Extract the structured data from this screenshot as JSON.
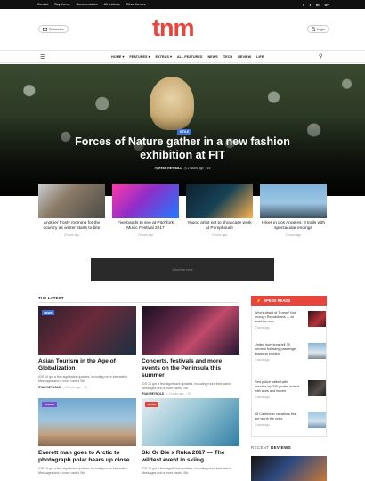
{
  "topbar": {
    "links": [
      "Contact",
      "Buy theme",
      "Documentation",
      "All features",
      "Other themes"
    ],
    "social": [
      "f",
      "t",
      "in",
      "G+"
    ]
  },
  "header": {
    "subscribe": "Subscribe",
    "logo": "tnm",
    "login": "Login",
    "brand_color": "#e8453c"
  },
  "nav": {
    "items": [
      "HOME ▾",
      "FEATURES ▾",
      "EXTRAS ▾",
      "ALL FEATURES",
      "NEWS",
      "TECH",
      "REVIEW",
      "LIFE"
    ]
  },
  "hero": {
    "category": "STYLE",
    "title": "Forces of Nature gather in a new fashion exhibition at FIT",
    "by": "by",
    "author": "RYAN REYNOLD",
    "date": "2 hours ago",
    "comments": "15"
  },
  "sub_stories": [
    {
      "title": "Another frosty morning for the country as winter starts to bite",
      "time": "2 hours ago"
    },
    {
      "title": "Five bands to see at Pitchfork Music Festival 2017",
      "time": "2 hours ago"
    },
    {
      "title": "Young artist set to showcase work at Pumphouse",
      "time": "2 hours ago"
    },
    {
      "title": "Hikes in Los Angeles: 8 trails with spectacular endings",
      "time": "2 hours ago"
    }
  ],
  "ad": {
    "text": "Advertise here"
  },
  "latest": {
    "title": "THE LATEST",
    "cards": [
      {
        "tag": "NEWS",
        "tag_color": "#3b6fd4",
        "title": "Asian Tourism in the Age of Globalization",
        "excerpt": "iOS 10 got a few significant updates, including more interactive Messages and a more useful Siri.",
        "author": "RYAN REYNOLD",
        "time": "2 hours ago",
        "comments": "13"
      },
      {
        "tag": "",
        "tag_color": "",
        "title": "Concerts, festivals and more events on the Peninsula this summer",
        "excerpt": "iOS 10 got a few significant updates, including more interactive Messages and a more useful Siri.",
        "author": "RYAN REYNOLD",
        "time": "2 hours ago",
        "comments": "13"
      },
      {
        "tag": "TRAVEL",
        "tag_color": "#7b4fd4",
        "title": "Everett man goes to Arctic to photograph polar bears up close",
        "excerpt": "iOS 10 got a few significant updates, including more interactive Messages and a more useful Siri.",
        "author": "",
        "time": "",
        "comments": ""
      },
      {
        "tag": "SPORT",
        "tag_color": "#e8453c",
        "title": "Ski Or Die x Ruka 2017 — The wildest event in skiing",
        "excerpt": "iOS 10 got a few significant updates, including more interactive Messages and a more useful Siri.",
        "author": "",
        "time": "",
        "comments": ""
      }
    ]
  },
  "speed_reads": {
    "label": "SPEED READS",
    "items": [
      {
        "title": "Who's afraid of Trump? Not enough Republicans — at least for now",
        "time": "2 hours ago"
      },
      {
        "title": "United bumpings fell 79 percent following passenger dragging incident",
        "time": "2 hours ago"
      },
      {
        "title": "Red police patted with missiles by 200 youths armed with axes and knives",
        "time": "2 hours ago"
      },
      {
        "title": "15 Caribbean vacations that are worth the price",
        "time": "2 hours ago"
      }
    ]
  },
  "recent_reviews": {
    "prefix": "RECENT",
    "label": "REVIEWS"
  }
}
